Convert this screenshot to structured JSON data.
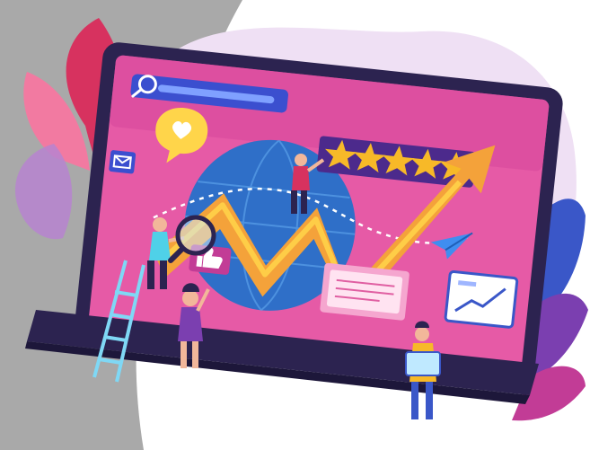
{
  "illustration": {
    "subject": "laptop-growth-marketing-illustration",
    "rating_stars": 5,
    "palette": {
      "backdrop_gray": "#a9a9a9",
      "blob_lavender": "#efe0f4",
      "laptop_frame": "#2c2350",
      "screen_pink": "#e65aa6",
      "screen_magenta": "#c23c96",
      "globe_blue": "#2f6fc8",
      "arrow_orange": "#f4a23a",
      "arrow_yellow": "#ffd54a",
      "leaf_red": "#d7325f",
      "leaf_purple": "#7b3fb0",
      "leaf_blue": "#3a57c8",
      "star_gold": "#f7b928",
      "search_bar_blue": "#3b4fcf"
    },
    "icons": [
      "search-icon",
      "heart-icon",
      "envelope-icon",
      "thumbs-up-icon",
      "paper-plane-icon",
      "chart-card-icon",
      "magnifier-icon",
      "ladder-icon"
    ]
  }
}
